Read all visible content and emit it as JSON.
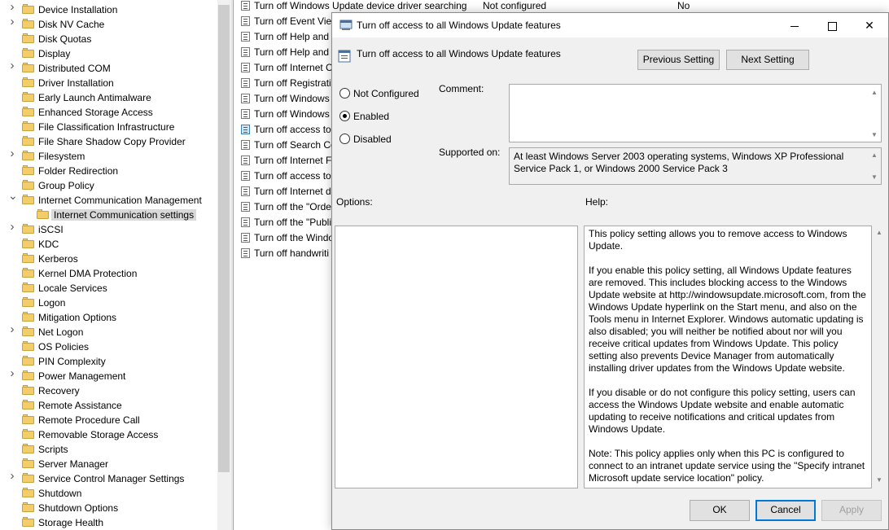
{
  "tree": {
    "items": [
      {
        "label": "Device Installation",
        "expander": "chevron-right"
      },
      {
        "label": "Disk NV Cache",
        "expander": "chevron-right"
      },
      {
        "label": "Disk Quotas",
        "expander": ""
      },
      {
        "label": "Display",
        "expander": ""
      },
      {
        "label": "Distributed COM",
        "expander": "chevron-right"
      },
      {
        "label": "Driver Installation",
        "expander": ""
      },
      {
        "label": "Early Launch Antimalware",
        "expander": ""
      },
      {
        "label": "Enhanced Storage Access",
        "expander": ""
      },
      {
        "label": "File Classification Infrastructure",
        "expander": ""
      },
      {
        "label": "File Share Shadow Copy Provider",
        "expander": ""
      },
      {
        "label": "Filesystem",
        "expander": "chevron-right"
      },
      {
        "label": "Folder Redirection",
        "expander": ""
      },
      {
        "label": "Group Policy",
        "expander": ""
      },
      {
        "label": "Internet Communication Management",
        "expander": "chevron-down"
      },
      {
        "label": "Internet Communication settings",
        "expander": "",
        "selected": true,
        "child": true
      },
      {
        "label": "iSCSI",
        "expander": "chevron-right"
      },
      {
        "label": "KDC",
        "expander": ""
      },
      {
        "label": "Kerberos",
        "expander": ""
      },
      {
        "label": "Kernel DMA Protection",
        "expander": ""
      },
      {
        "label": "Locale Services",
        "expander": ""
      },
      {
        "label": "Logon",
        "expander": ""
      },
      {
        "label": "Mitigation Options",
        "expander": ""
      },
      {
        "label": "Net Logon",
        "expander": "chevron-right"
      },
      {
        "label": "OS Policies",
        "expander": ""
      },
      {
        "label": "PIN Complexity",
        "expander": ""
      },
      {
        "label": "Power Management",
        "expander": "chevron-right"
      },
      {
        "label": "Recovery",
        "expander": ""
      },
      {
        "label": "Remote Assistance",
        "expander": ""
      },
      {
        "label": "Remote Procedure Call",
        "expander": ""
      },
      {
        "label": "Removable Storage Access",
        "expander": ""
      },
      {
        "label": "Scripts",
        "expander": ""
      },
      {
        "label": "Server Manager",
        "expander": ""
      },
      {
        "label": "Service Control Manager Settings",
        "expander": "chevron-right"
      },
      {
        "label": "Shutdown",
        "expander": ""
      },
      {
        "label": "Shutdown Options",
        "expander": ""
      },
      {
        "label": "Storage Health",
        "expander": ""
      }
    ]
  },
  "list": {
    "rows": [
      {
        "setting": "Turn off Windows Update device driver searching",
        "state": "Not configured",
        "comment": "No"
      },
      {
        "setting": "Turn off Event Viewer",
        "state": "",
        "comment": ""
      },
      {
        "setting": "Turn off Help and",
        "state": "",
        "comment": ""
      },
      {
        "setting": "Turn off Help and",
        "state": "",
        "comment": ""
      },
      {
        "setting": "Turn off Internet C",
        "state": "",
        "comment": ""
      },
      {
        "setting": "Turn off Registrati",
        "state": "",
        "comment": ""
      },
      {
        "setting": "Turn off Windows",
        "state": "",
        "comment": ""
      },
      {
        "setting": "Turn off Windows",
        "state": "",
        "comment": ""
      },
      {
        "setting": "Turn off access to",
        "state": "",
        "comment": "",
        "active": true
      },
      {
        "setting": "Turn off Search Co",
        "state": "",
        "comment": ""
      },
      {
        "setting": "Turn off Internet F",
        "state": "",
        "comment": ""
      },
      {
        "setting": "Turn off access to",
        "state": "",
        "comment": ""
      },
      {
        "setting": "Turn off Internet d",
        "state": "",
        "comment": ""
      },
      {
        "setting": "Turn off the \"Orde",
        "state": "",
        "comment": ""
      },
      {
        "setting": "Turn off the \"Publi",
        "state": "",
        "comment": ""
      },
      {
        "setting": "Turn off the Windo",
        "state": "",
        "comment": ""
      },
      {
        "setting": "Turn off handwriti",
        "state": "",
        "comment": ""
      }
    ]
  },
  "dialog": {
    "window_title": "Turn off access to all Windows Update features",
    "header_title": "Turn off access to all Windows Update features",
    "prev_label": "Previous Setting",
    "next_label": "Next Setting",
    "radios": [
      {
        "label": "Not Configured",
        "checked": false
      },
      {
        "label": "Enabled",
        "checked": true
      },
      {
        "label": "Disabled",
        "checked": false
      }
    ],
    "comment_label": "Comment:",
    "comment_value": "",
    "supported_label": "Supported on:",
    "supported_value": "At least Windows Server 2003 operating systems, Windows XP Professional Service Pack 1, or Windows 2000 Service Pack 3",
    "options_label": "Options:",
    "help_label": "Help:",
    "help_paragraphs": [
      "This policy setting allows you to remove access to Windows Update.",
      "If you enable this policy setting, all Windows Update features are removed. This includes blocking access to the Windows Update website at http://windowsupdate.microsoft.com, from the Windows Update hyperlink on the Start menu, and also on the Tools menu in Internet Explorer. Windows automatic updating is also disabled; you will neither be notified about nor will you receive critical updates from Windows Update. This policy setting also prevents Device Manager from automatically installing driver updates from the Windows Update website.",
      "If you disable or do not configure this policy setting, users can access the Windows Update website and enable automatic updating to receive notifications and critical updates from Windows Update.",
      "Note: This policy applies only when this PC is configured to connect to an intranet update service using the \"Specify intranet Microsoft update service location\" policy."
    ],
    "ok_label": "OK",
    "cancel_label": "Cancel",
    "apply_label": "Apply"
  },
  "colors": {
    "dialog_bg": "#f0f0f0",
    "folder": "#f3cd6a",
    "default_button_border": "#0078d7",
    "selection": "#d9d9d9"
  }
}
